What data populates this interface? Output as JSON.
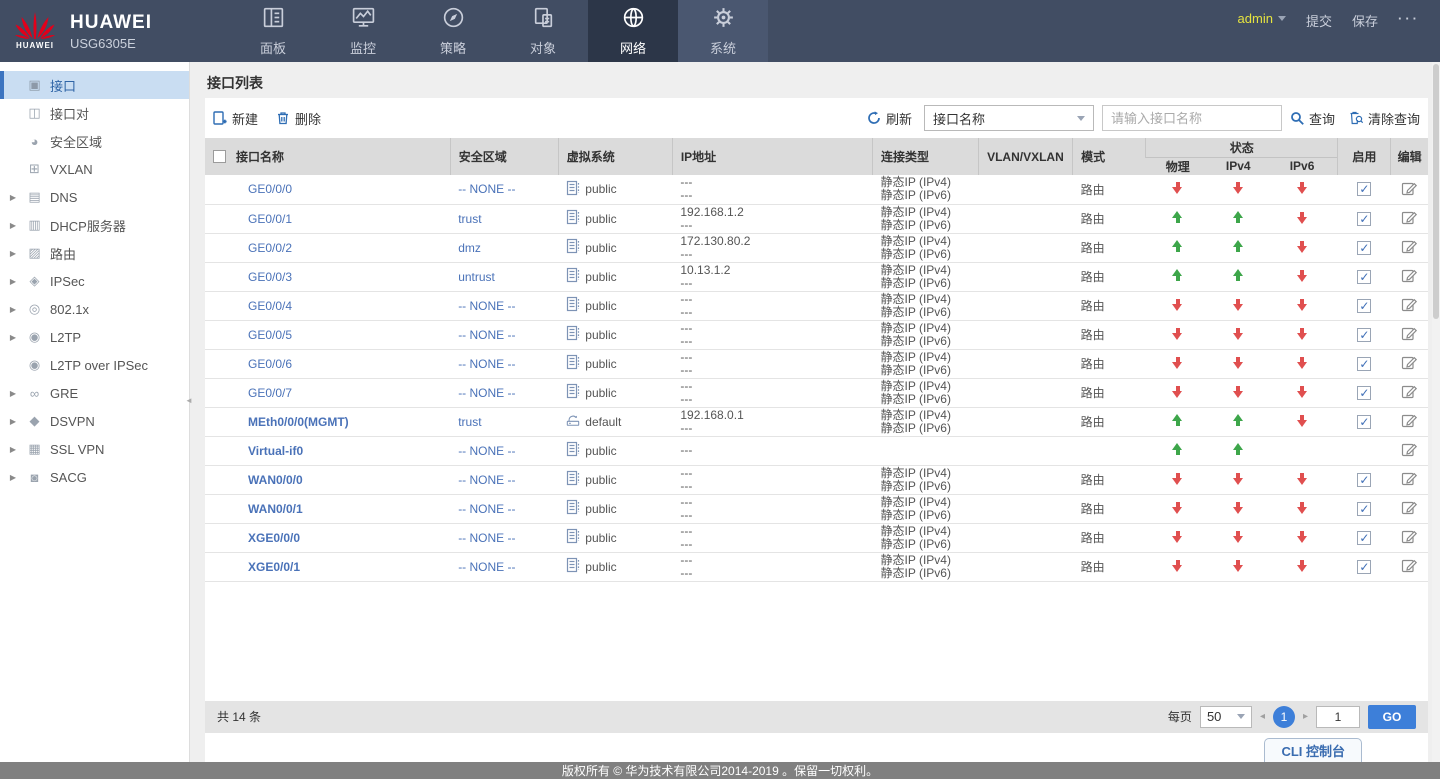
{
  "colors": {
    "accent": "#3D7FD9",
    "nav_bg": "#414D63",
    "nav_active_bg": "#2C3648",
    "link": "#4A72B8",
    "status_up": "#3DA64A",
    "status_down": "#E04F4F",
    "selected_item_bg": "#C9DDF2",
    "admin_text": "#E6E33F",
    "footer_bg": "#808080"
  },
  "header": {
    "brand": "HUAWEI",
    "model": "USG6305E",
    "logo_wordmark": "HUAWEI",
    "nav": [
      {
        "key": "dashboard",
        "label": "面板",
        "icon": "dashboard-icon",
        "active": false
      },
      {
        "key": "monitor",
        "label": "监控",
        "icon": "monitor-icon",
        "active": false
      },
      {
        "key": "policy",
        "label": "策略",
        "icon": "policy-icon",
        "active": false
      },
      {
        "key": "object",
        "label": "对象",
        "icon": "object-icon",
        "active": false
      },
      {
        "key": "network",
        "label": "网络",
        "icon": "network-icon",
        "active": true
      },
      {
        "key": "system",
        "label": "系统",
        "icon": "system-icon",
        "active": false
      }
    ],
    "user": "admin",
    "submit": "提交",
    "save": "保存",
    "more": "···"
  },
  "sidebar": {
    "items": [
      {
        "key": "interface",
        "label": "接口",
        "icon": "interface-icon",
        "glyph": "▣",
        "expandable": false,
        "selected": true
      },
      {
        "key": "interface-pair",
        "label": "接口对",
        "icon": "interface-pair-icon",
        "glyph": "◫",
        "expandable": false,
        "selected": false
      },
      {
        "key": "security-zone",
        "label": "安全区域",
        "icon": "security-zone-icon",
        "glyph": "◕",
        "expandable": false,
        "selected": false
      },
      {
        "key": "vxlan",
        "label": "VXLAN",
        "icon": "vxlan-icon",
        "glyph": "⊞",
        "expandable": false,
        "selected": false
      },
      {
        "key": "dns",
        "label": "DNS",
        "icon": "dns-icon",
        "glyph": "▤",
        "expandable": true,
        "selected": false
      },
      {
        "key": "dhcp-server",
        "label": "DHCP服务器",
        "icon": "dhcp-server-icon",
        "glyph": "▥",
        "expandable": true,
        "selected": false
      },
      {
        "key": "route",
        "label": "路由",
        "icon": "route-icon",
        "glyph": "▨",
        "expandable": true,
        "selected": false
      },
      {
        "key": "ipsec",
        "label": "IPSec",
        "icon": "ipsec-icon",
        "glyph": "◈",
        "expandable": true,
        "selected": false
      },
      {
        "key": "8021x",
        "label": "802.1x",
        "icon": "dot1x-icon",
        "glyph": "◎",
        "expandable": true,
        "selected": false
      },
      {
        "key": "l2tp",
        "label": "L2TP",
        "icon": "l2tp-icon",
        "glyph": "◉",
        "expandable": true,
        "selected": false
      },
      {
        "key": "l2tp-over-ipsec",
        "label": "L2TP over IPSec",
        "icon": "l2tp-over-ipsec-icon",
        "glyph": "◉",
        "expandable": false,
        "selected": false
      },
      {
        "key": "gre",
        "label": "GRE",
        "icon": "gre-icon",
        "glyph": "∞",
        "expandable": true,
        "selected": false
      },
      {
        "key": "dsvpn",
        "label": "DSVPN",
        "icon": "dsvpn-icon",
        "glyph": "◆",
        "expandable": true,
        "selected": false
      },
      {
        "key": "ssl-vpn",
        "label": "SSL VPN",
        "icon": "ssl-vpn-icon",
        "glyph": "▦",
        "expandable": true,
        "selected": false
      },
      {
        "key": "sacg",
        "label": "SACG",
        "icon": "sacg-icon",
        "glyph": "◙",
        "expandable": true,
        "selected": false
      }
    ]
  },
  "main": {
    "title": "接口列表",
    "toolbar": {
      "new_label": "新建",
      "delete_label": "删除",
      "refresh_label": "刷新",
      "filter_field_value": "接口名称",
      "search_placeholder": "请输入接口名称",
      "query_label": "查询",
      "clear_query_label": "清除查询"
    },
    "table": {
      "columns": {
        "name": "接口名称",
        "zone": "安全区域",
        "vsys": "虚拟系统",
        "ip": "IP地址",
        "conn": "连接类型",
        "vlan": "VLAN/VXLAN",
        "mode": "模式",
        "status": "状态",
        "phy": "物理",
        "ipv4": "IPv4",
        "ipv6": "IPv6",
        "enable": "启用",
        "edit": "编辑"
      },
      "rows": [
        {
          "name": "GE0/0/0",
          "bold": false,
          "zone": "-- NONE --",
          "vsys": "public",
          "ip": [
            "---",
            "---"
          ],
          "conn": [
            "静态IP (IPv4)",
            "静态IP (IPv6)"
          ],
          "vlan": "",
          "mode": "路由",
          "phy": "down",
          "ipv4": "down",
          "ipv6": "down",
          "enable": true
        },
        {
          "name": "GE0/0/1",
          "bold": false,
          "zone": "trust",
          "vsys": "public",
          "ip": [
            "192.168.1.2",
            "---"
          ],
          "conn": [
            "静态IP (IPv4)",
            "静态IP (IPv6)"
          ],
          "vlan": "",
          "mode": "路由",
          "phy": "up",
          "ipv4": "up",
          "ipv6": "down",
          "enable": true
        },
        {
          "name": "GE0/0/2",
          "bold": false,
          "zone": "dmz",
          "vsys": "public",
          "ip": [
            "172.130.80.2",
            "---"
          ],
          "conn": [
            "静态IP (IPv4)",
            "静态IP (IPv6)"
          ],
          "vlan": "",
          "mode": "路由",
          "phy": "up",
          "ipv4": "up",
          "ipv6": "down",
          "enable": true
        },
        {
          "name": "GE0/0/3",
          "bold": false,
          "zone": "untrust",
          "vsys": "public",
          "ip": [
            "10.13.1.2",
            "---"
          ],
          "conn": [
            "静态IP (IPv4)",
            "静态IP (IPv6)"
          ],
          "vlan": "",
          "mode": "路由",
          "phy": "up",
          "ipv4": "up",
          "ipv6": "down",
          "enable": true
        },
        {
          "name": "GE0/0/4",
          "bold": false,
          "zone": "-- NONE --",
          "vsys": "public",
          "ip": [
            "---",
            "---"
          ],
          "conn": [
            "静态IP (IPv4)",
            "静态IP (IPv6)"
          ],
          "vlan": "",
          "mode": "路由",
          "phy": "down",
          "ipv4": "down",
          "ipv6": "down",
          "enable": true
        },
        {
          "name": "GE0/0/5",
          "bold": false,
          "zone": "-- NONE --",
          "vsys": "public",
          "ip": [
            "---",
            "---"
          ],
          "conn": [
            "静态IP (IPv4)",
            "静态IP (IPv6)"
          ],
          "vlan": "",
          "mode": "路由",
          "phy": "down",
          "ipv4": "down",
          "ipv6": "down",
          "enable": true
        },
        {
          "name": "GE0/0/6",
          "bold": false,
          "zone": "-- NONE --",
          "vsys": "public",
          "ip": [
            "---",
            "---"
          ],
          "conn": [
            "静态IP (IPv4)",
            "静态IP (IPv6)"
          ],
          "vlan": "",
          "mode": "路由",
          "phy": "down",
          "ipv4": "down",
          "ipv6": "down",
          "enable": true
        },
        {
          "name": "GE0/0/7",
          "bold": false,
          "zone": "-- NONE --",
          "vsys": "public",
          "ip": [
            "---",
            "---"
          ],
          "conn": [
            "静态IP (IPv4)",
            "静态IP (IPv6)"
          ],
          "vlan": "",
          "mode": "路由",
          "phy": "down",
          "ipv4": "down",
          "ipv6": "down",
          "enable": true
        },
        {
          "name": "MEth0/0/0(MGMT)",
          "bold": true,
          "zone": "trust",
          "vsys": "default",
          "ip": [
            "192.168.0.1",
            "---"
          ],
          "conn": [
            "静态IP (IPv4)",
            "静态IP (IPv6)"
          ],
          "vlan": "",
          "mode": "路由",
          "phy": "up",
          "ipv4": "up",
          "ipv6": "down",
          "enable": true
        },
        {
          "name": "Virtual-if0",
          "bold": true,
          "zone": "-- NONE --",
          "vsys": "public",
          "ip": [
            "---"
          ],
          "conn": [],
          "vlan": "",
          "mode": "",
          "phy": "up",
          "ipv4": "up",
          "ipv6": "",
          "enable": null
        },
        {
          "name": "WAN0/0/0",
          "bold": true,
          "zone": "-- NONE --",
          "vsys": "public",
          "ip": [
            "---",
            "---"
          ],
          "conn": [
            "静态IP (IPv4)",
            "静态IP (IPv6)"
          ],
          "vlan": "",
          "mode": "路由",
          "phy": "down",
          "ipv4": "down",
          "ipv6": "down",
          "enable": true
        },
        {
          "name": "WAN0/0/1",
          "bold": true,
          "zone": "-- NONE --",
          "vsys": "public",
          "ip": [
            "---",
            "---"
          ],
          "conn": [
            "静态IP (IPv4)",
            "静态IP (IPv6)"
          ],
          "vlan": "",
          "mode": "路由",
          "phy": "down",
          "ipv4": "down",
          "ipv6": "down",
          "enable": true
        },
        {
          "name": "XGE0/0/0",
          "bold": true,
          "zone": "-- NONE --",
          "vsys": "public",
          "ip": [
            "---",
            "---"
          ],
          "conn": [
            "静态IP (IPv4)",
            "静态IP (IPv6)"
          ],
          "vlan": "",
          "mode": "路由",
          "phy": "down",
          "ipv4": "down",
          "ipv6": "down",
          "enable": true
        },
        {
          "name": "XGE0/0/1",
          "bold": true,
          "zone": "-- NONE --",
          "vsys": "public",
          "ip": [
            "---",
            "---"
          ],
          "conn": [
            "静态IP (IPv4)",
            "静态IP (IPv6)"
          ],
          "vlan": "",
          "mode": "路由",
          "phy": "down",
          "ipv4": "down",
          "ipv6": "down",
          "enable": true
        }
      ]
    },
    "pagination": {
      "total_label": "共 14 条",
      "per_page_label": "每页",
      "per_page_value": "50",
      "page": "1",
      "goto_value": "1",
      "go_label": "GO"
    }
  },
  "footer": {
    "cli_label": "CLI 控制台",
    "copyright": "版权所有 © 华为技术有限公司2014-2019 。保留一切权利。"
  }
}
